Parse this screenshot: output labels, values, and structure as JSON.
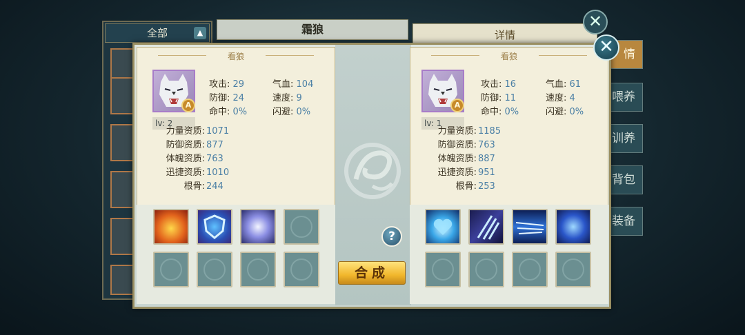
{
  "background": {
    "filter_label": "全部",
    "pet_title": "霜狼",
    "detail_tab": "详情",
    "side_tabs": [
      "情",
      "喂养",
      "训养",
      "背包",
      "装备"
    ]
  },
  "left_pet": {
    "title": "看狼",
    "grade": "A",
    "level": "lv: 2",
    "stats": [
      {
        "label": "攻击:",
        "value": "29"
      },
      {
        "label": "气血:",
        "value": "104"
      },
      {
        "label": "防御:",
        "value": "24"
      },
      {
        "label": "速度:",
        "value": "9"
      },
      {
        "label": "命中:",
        "value": "0%"
      },
      {
        "label": "闪避:",
        "value": "0%"
      }
    ],
    "aptitudes": [
      {
        "label": "力量资质:",
        "value": "1071"
      },
      {
        "label": "防御资质:",
        "value": "877"
      },
      {
        "label": "体魄资质:",
        "value": "763"
      },
      {
        "label": "迅捷资质:",
        "value": "1010"
      },
      {
        "label": "根骨:",
        "value": "244"
      }
    ],
    "skills": [
      "fire-tiger-skill-icon",
      "shield-skill-icon",
      "vortex-skill-icon"
    ]
  },
  "right_pet": {
    "title": "看狼",
    "grade": "A",
    "level": "lv: 1",
    "stats": [
      {
        "label": "攻击:",
        "value": "16"
      },
      {
        "label": "气血:",
        "value": "61"
      },
      {
        "label": "防御:",
        "value": "11"
      },
      {
        "label": "速度:",
        "value": "4"
      },
      {
        "label": "命中:",
        "value": "0%"
      },
      {
        "label": "闪避:",
        "value": "0%"
      }
    ],
    "aptitudes": [
      {
        "label": "力量资质:",
        "value": "1185"
      },
      {
        "label": "防御资质:",
        "value": "763"
      },
      {
        "label": "体魄资质:",
        "value": "887"
      },
      {
        "label": "迅捷资质:",
        "value": "951"
      },
      {
        "label": "根骨:",
        "value": "253"
      }
    ],
    "skills": [
      "heart-skill-icon",
      "claw-skill-icon",
      "wind-skill-icon",
      "whirlwind-skill-icon"
    ]
  },
  "help_label": "?",
  "merge_label": "合成",
  "close_glyph": "✕",
  "colors": {
    "stat_value": "#4a7fa5",
    "grade": "#c78a2a",
    "merge": "#f1b72c"
  }
}
